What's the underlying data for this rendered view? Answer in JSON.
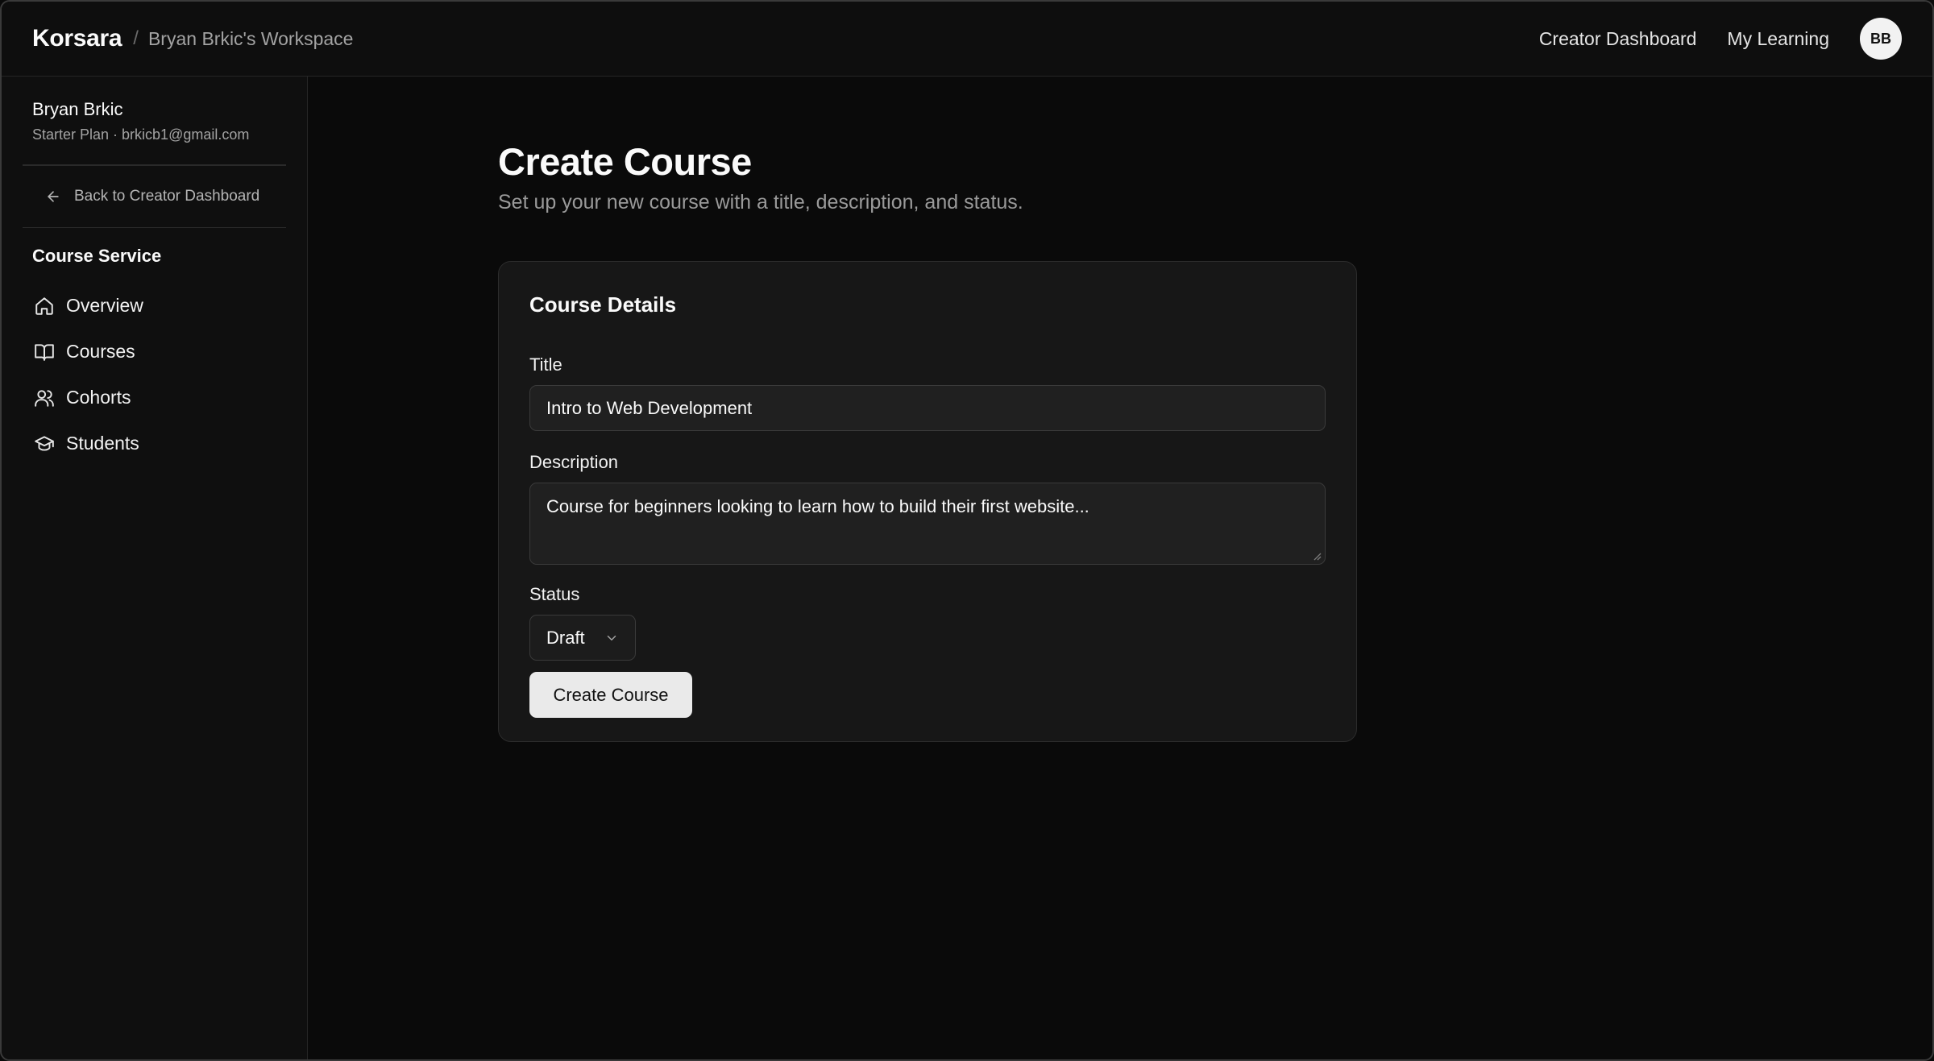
{
  "header": {
    "brand": "Korsara",
    "separator": "/",
    "workspace": "Bryan Brkic's Workspace",
    "nav": [
      "Creator Dashboard",
      "My Learning"
    ],
    "avatar_initials": "BB"
  },
  "sidebar": {
    "user_name": "Bryan Brkic",
    "user_meta": "Starter Plan · brkicb1@gmail.com",
    "back_label": "Back to Creator Dashboard",
    "section_title": "Course Service",
    "items": [
      {
        "label": "Overview",
        "icon": "home-icon"
      },
      {
        "label": "Courses",
        "icon": "book-open-icon"
      },
      {
        "label": "Cohorts",
        "icon": "users-icon"
      },
      {
        "label": "Students",
        "icon": "graduation-cap-icon"
      }
    ]
  },
  "main": {
    "title": "Create Course",
    "subtitle": "Set up your new course with a title, description, and status.",
    "card": {
      "title": "Course Details",
      "title_label": "Title",
      "title_value": "Intro to Web Development",
      "description_label": "Description",
      "description_value": "Course for beginners looking to learn how to build their first website...",
      "status_label": "Status",
      "status_value": "Draft",
      "submit_label": "Create Course"
    }
  },
  "colors": {
    "background": "#0a0a0a",
    "card": "#171717",
    "button": "#eaeaea",
    "muted_text": "#a3a3a3"
  }
}
